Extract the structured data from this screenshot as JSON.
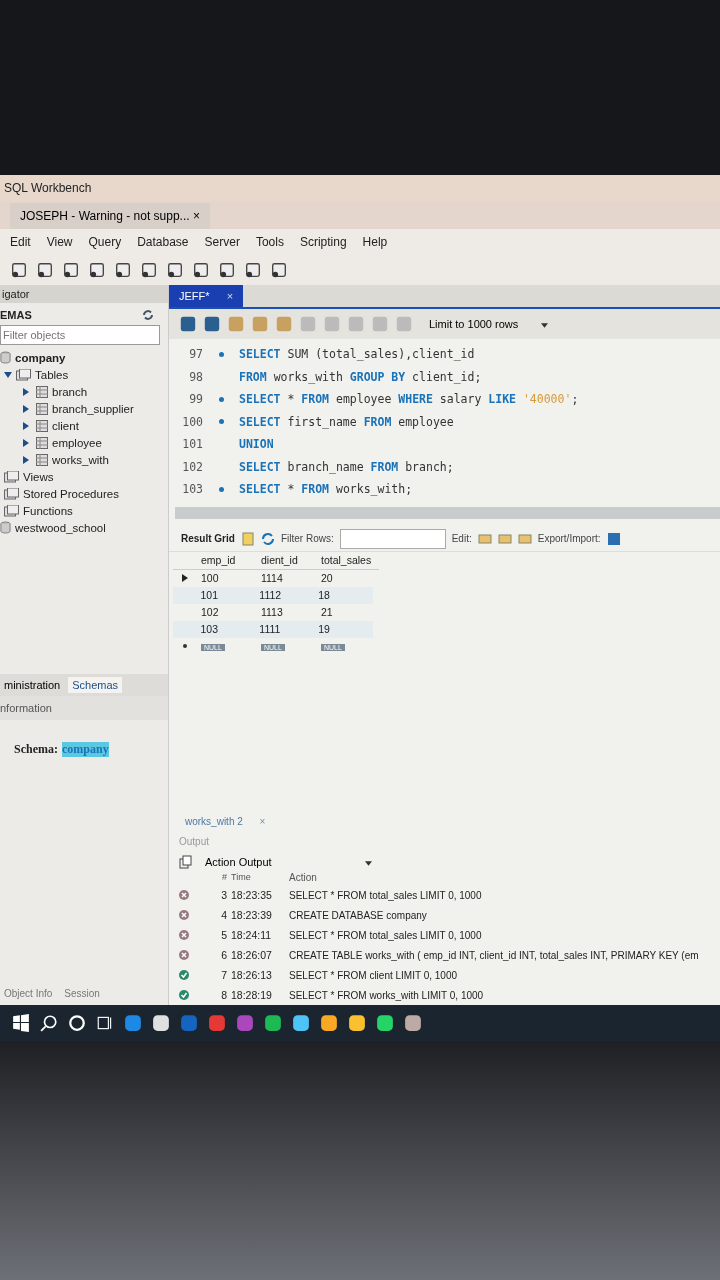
{
  "window": {
    "title": "SQL Workbench"
  },
  "connection_tab": {
    "label": "JOSEPH - Warning - not supp...",
    "close": "×"
  },
  "menu": [
    "Edit",
    "View",
    "Query",
    "Database",
    "Server",
    "Tools",
    "Scripting",
    "Help"
  ],
  "navigator": {
    "title": "igator",
    "section": "EMAS",
    "filter": {
      "placeholder": "Filter objects"
    },
    "tree": [
      {
        "label": "company",
        "bold": true,
        "kind": "schema",
        "children": [
          {
            "label": "Tables",
            "kind": "folder",
            "expanded": true,
            "children": [
              {
                "label": "branch",
                "kind": "table",
                "expanded": false
              },
              {
                "label": "branch_supplier",
                "kind": "table",
                "expanded": false
              },
              {
                "label": "client",
                "kind": "table",
                "expanded": false
              },
              {
                "label": "employee",
                "kind": "table",
                "expanded": false
              },
              {
                "label": "works_with",
                "kind": "table",
                "expanded": false
              }
            ]
          },
          {
            "label": "Views",
            "kind": "folder"
          },
          {
            "label": "Stored Procedures",
            "kind": "folder"
          },
          {
            "label": "Functions",
            "kind": "folder"
          }
        ]
      },
      {
        "label": "westwood_school",
        "bold": false,
        "kind": "schema"
      }
    ],
    "tabs": [
      {
        "label": "ministration",
        "selected": false
      },
      {
        "label": "Schemas",
        "selected": true
      }
    ],
    "info_title": "nformation",
    "schema_label": "Schema:",
    "schema_value": "company",
    "bottom_tabs": [
      {
        "label": "Object Info",
        "selected": false
      },
      {
        "label": "Session",
        "selected": false
      }
    ]
  },
  "editor": {
    "tab": {
      "label": "JEFF*",
      "close": "×"
    },
    "limit": "Limit to 1000 rows",
    "lines": [
      {
        "number": "97",
        "dot": true,
        "tokens": [
          {
            "kind": "keyword",
            "text": "SELECT"
          },
          {
            "kind": "plain",
            "text": " SUM (total_sales),client_id"
          }
        ]
      },
      {
        "number": "98",
        "dot": false,
        "tokens": [
          {
            "kind": "keyword",
            "text": "FROM"
          },
          {
            "kind": "plain",
            "text": " works_with "
          },
          {
            "kind": "keyword",
            "text": "GROUP BY"
          },
          {
            "kind": "plain",
            "text": " client_id;"
          }
        ]
      },
      {
        "number": "99",
        "dot": true,
        "tokens": [
          {
            "kind": "keyword",
            "text": "SELECT"
          },
          {
            "kind": "plain",
            "text": " * "
          },
          {
            "kind": "keyword",
            "text": "FROM"
          },
          {
            "kind": "plain",
            "text": " employee "
          },
          {
            "kind": "keyword",
            "text": "WHERE"
          },
          {
            "kind": "plain",
            "text": " salary "
          },
          {
            "kind": "keyword",
            "text": "LIKE"
          },
          {
            "kind": "string",
            "text": " '40000'"
          },
          {
            "kind": "plain",
            "text": ";"
          }
        ]
      },
      {
        "number": "100",
        "dot": true,
        "tokens": [
          {
            "kind": "keyword",
            "text": "SELECT"
          },
          {
            "kind": "plain",
            "text": " first_name "
          },
          {
            "kind": "keyword",
            "text": "FROM"
          },
          {
            "kind": "plain",
            "text": " employee"
          }
        ]
      },
      {
        "number": "101",
        "dot": false,
        "tokens": [
          {
            "kind": "keyword",
            "text": "UNION"
          }
        ]
      },
      {
        "number": "102",
        "dot": false,
        "tokens": [
          {
            "kind": "keyword",
            "text": "SELECT"
          },
          {
            "kind": "plain",
            "text": " branch_name "
          },
          {
            "kind": "keyword",
            "text": "FROM"
          },
          {
            "kind": "plain",
            "text": " branch;"
          }
        ]
      },
      {
        "number": "103",
        "dot": true,
        "tokens": [
          {
            "kind": "keyword",
            "text": "SELECT"
          },
          {
            "kind": "plain",
            "text": " * "
          },
          {
            "kind": "keyword",
            "text": "FROM"
          },
          {
            "kind": "plain",
            "text": " works_with;"
          }
        ]
      }
    ]
  },
  "results": {
    "title": "Result Grid",
    "filter_label": "Filter Rows:",
    "edit_label": "Edit:",
    "export_label": "Export/Import:",
    "columns": [
      "emp_id",
      "dient_id",
      "total_sales"
    ],
    "rows": [
      {
        "selected": true,
        "cells": [
          "100",
          "1114",
          "20"
        ]
      },
      {
        "selected": false,
        "cells": [
          "101",
          "1112",
          "18"
        ]
      },
      {
        "selected": false,
        "cells": [
          "102",
          "1113",
          "21"
        ]
      },
      {
        "selected": false,
        "cells": [
          "103",
          "1111",
          "19"
        ]
      }
    ],
    "null_row": [
      "NULL",
      "NULL",
      "NULL"
    ]
  },
  "result_tab": {
    "label": "works_with 2",
    "close": "×"
  },
  "output": {
    "title": "Output",
    "mode": "Action Output",
    "columns": [
      "#",
      "Time",
      "Action"
    ],
    "rows": [
      {
        "kind": "error",
        "number": "3",
        "time": "18:23:35",
        "action": "SELECT * FROM total_sales LIMIT 0, 1000"
      },
      {
        "kind": "error",
        "number": "4",
        "time": "18:23:39",
        "action": "CREATE DATABASE company"
      },
      {
        "kind": "error",
        "number": "5",
        "time": "18:24:11",
        "action": "SELECT * FROM total_sales LIMIT 0, 1000"
      },
      {
        "kind": "error",
        "number": "6",
        "time": "18:26:07",
        "action": "CREATE TABLE works_with ( emp_id INT, client_id INT, total_sales INT, PRIMARY KEY (em"
      },
      {
        "kind": "ok",
        "number": "7",
        "time": "18:26:13",
        "action": "SELECT * FROM client LIMIT 0, 1000"
      },
      {
        "kind": "ok",
        "number": "8",
        "time": "18:28:19",
        "action": "SELECT * FROM works_with LIMIT 0, 1000"
      }
    ]
  }
}
